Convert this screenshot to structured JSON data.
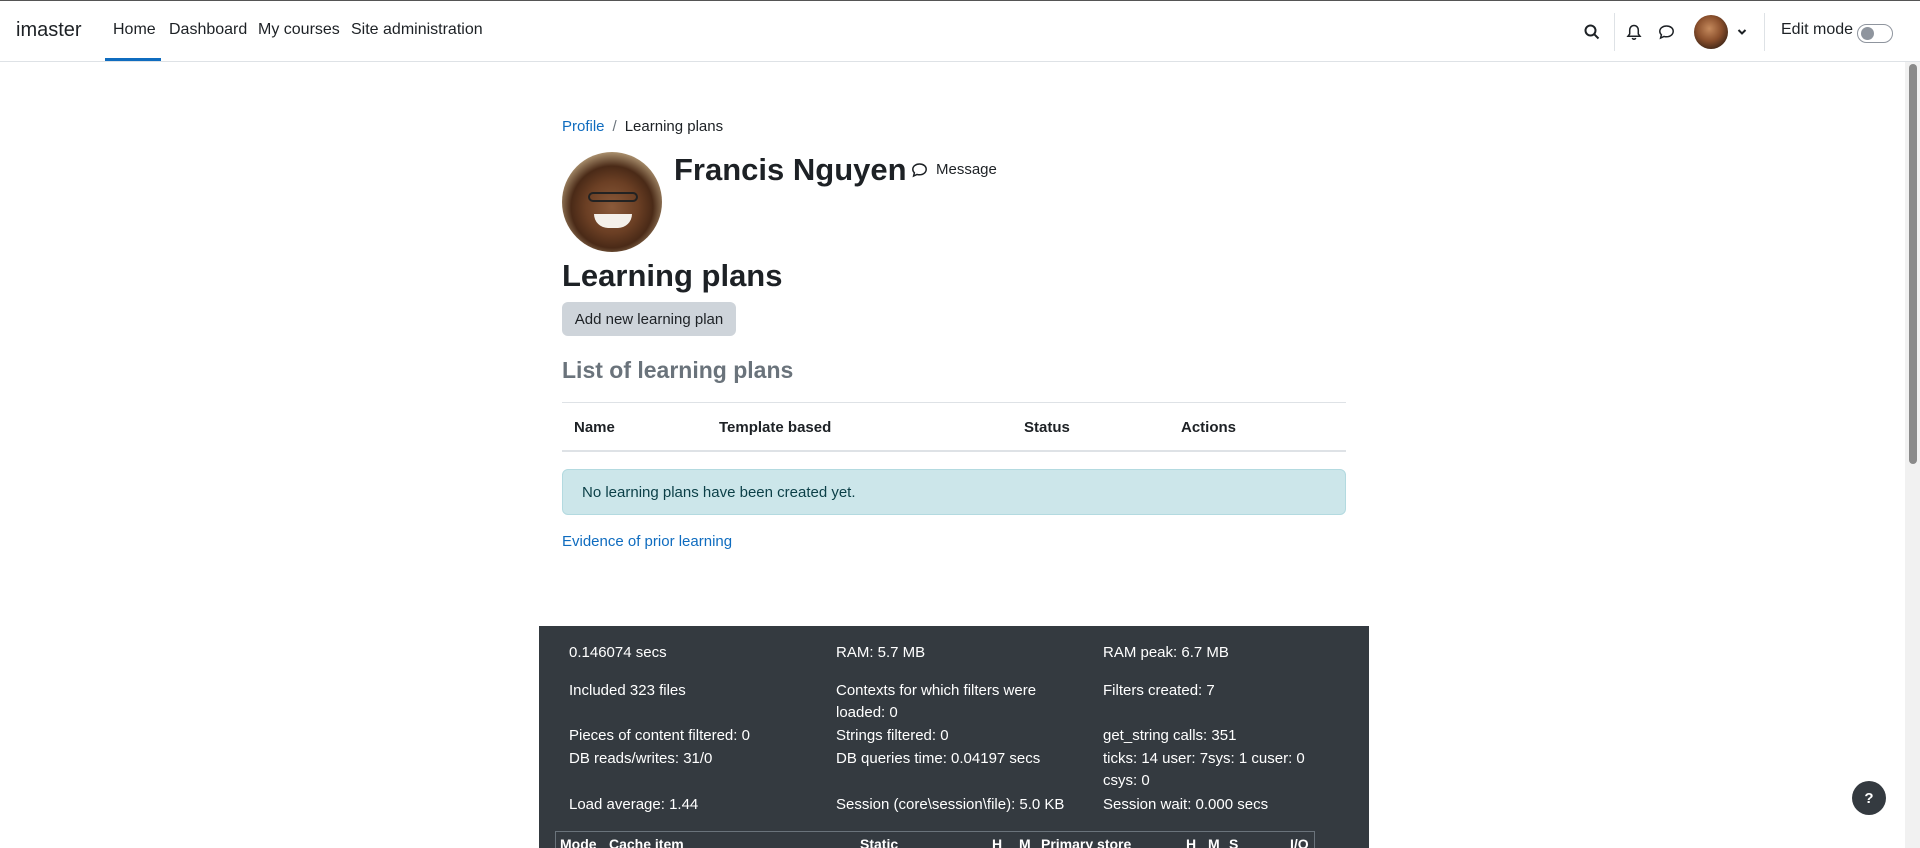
{
  "navbar": {
    "brand": "imaster",
    "links": [
      "Home",
      "Dashboard",
      "My courses",
      "Site administration"
    ],
    "edit_mode_label": "Edit mode"
  },
  "breadcrumb": {
    "items": [
      "Profile",
      "Learning plans"
    ]
  },
  "profile": {
    "name": "Francis Nguyen",
    "message_label": "Message"
  },
  "page": {
    "heading": "Learning plans",
    "add_button": "Add new learning plan",
    "list_heading": "List of learning plans",
    "table_headers": [
      "Name",
      "Template based",
      "Status",
      "Actions"
    ],
    "empty_message": "No learning plans have been created yet.",
    "evidence_link": "Evidence of prior learning"
  },
  "perf": {
    "time": "0.146074 secs",
    "ram": "RAM: 5.7 MB",
    "ram_peak": "RAM peak: 6.7 MB",
    "included_files": "Included 323 files",
    "contexts_line1": "Contexts for which filters were",
    "contexts_line2": "loaded: 0",
    "filters_created": "Filters created: 7",
    "pieces_filtered": "Pieces of content filtered: 0",
    "strings_filtered": "Strings filtered: 0",
    "get_string": "get_string calls: 351",
    "db_reads": "DB reads/writes: 31/0",
    "db_queries": "DB queries time: 0.04197 secs",
    "ticks_line1": "ticks: 14 user: 7sys: 1 cuser: 0",
    "ticks_line2": "csys: 0",
    "load_average": "Load average: 1.44",
    "session": "Session (core\\session\\file): 5.0 KB",
    "session_wait": "Session wait: 0.000 secs",
    "cache_headers": [
      "Mode",
      "Cache item",
      "Static",
      "H",
      "M",
      "Primary store",
      "H",
      "M",
      "S",
      "I/O"
    ]
  },
  "help_label": "?",
  "colors": {
    "link": "#0f6cbf",
    "alert_bg": "#cce6ea",
    "perf_bg": "#343a40",
    "button_bg": "#ced4da"
  }
}
